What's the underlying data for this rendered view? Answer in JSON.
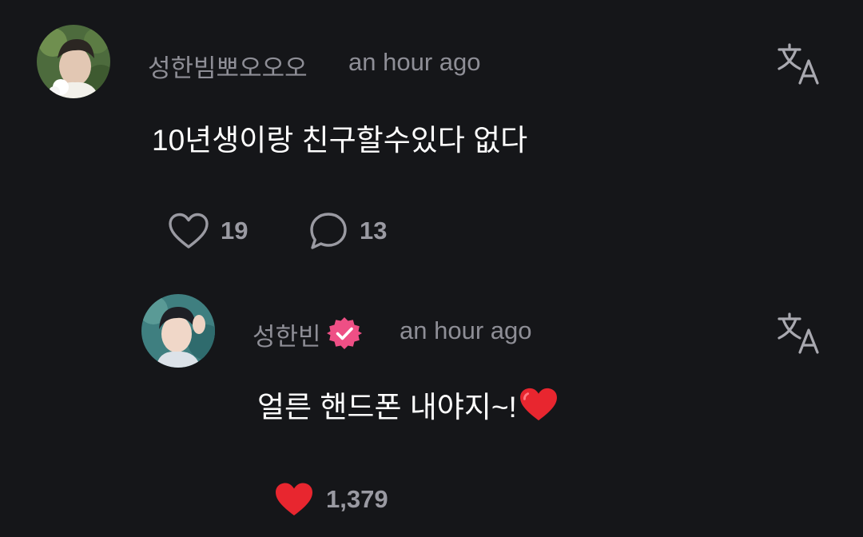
{
  "comment": {
    "author": "성한빔뽀오오오",
    "time": "an hour ago",
    "text": "10년생이랑 친구할수있다 없다",
    "likes": "19",
    "replies": "13"
  },
  "reply": {
    "author": "성한빈",
    "verified": true,
    "time": "an hour ago",
    "text": "얼른 핸드폰 내야지~!",
    "likes": "1,379",
    "liked": true
  },
  "colors": {
    "background": "#151619",
    "muted_text": "#8e8e96",
    "body_text": "#ffffff",
    "heart_red": "#e8262f",
    "verified_pink": "#ee4f85"
  },
  "icons": {
    "translate": "translate-icon",
    "like": "heart-outline-icon",
    "reply": "speech-bubble-icon",
    "liked": "heart-filled-icon",
    "verified": "verified-badge-icon"
  }
}
